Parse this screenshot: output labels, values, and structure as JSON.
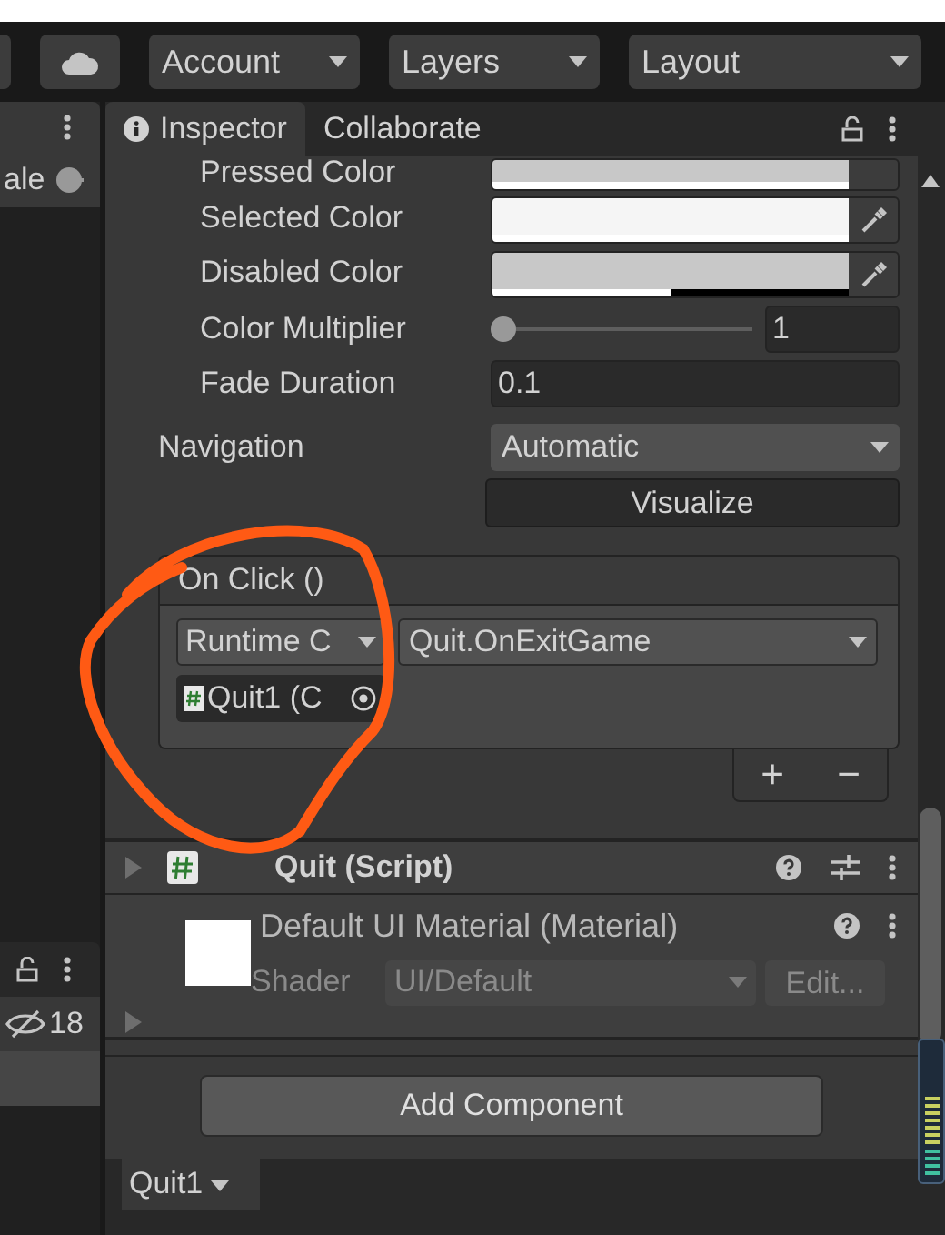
{
  "toolbar": {
    "buttons": [
      {
        "label": "Account"
      },
      {
        "label": "Layers"
      },
      {
        "label": "Layout"
      }
    ]
  },
  "left_panel": {
    "field_label": "ale",
    "hidden_count": "18"
  },
  "inspector": {
    "tabs": [
      {
        "label": "Inspector",
        "selected": true
      },
      {
        "label": "Collaborate",
        "selected": false
      }
    ],
    "color_rows": [
      {
        "label": "Pressed Color",
        "color": "#c8c8c8",
        "level": 1
      },
      {
        "label": "Selected Color",
        "color": "#f5f5f5",
        "level": 1
      },
      {
        "label": "Disabled Color",
        "color": "#c8c8c8",
        "level": 0.5
      }
    ],
    "color_multiplier": {
      "label": "Color Multiplier",
      "level": 0,
      "value": "1"
    },
    "fade_duration": {
      "label": "Fade Duration",
      "value": "0.1"
    },
    "navigation": {
      "label": "Navigation",
      "value": "Automatic",
      "button": "Visualize"
    },
    "on_click": {
      "title": "On Click ()",
      "runtime": "Runtime C",
      "function": "Quit.OnExitGame",
      "object": "Quit1 (C",
      "add": "+",
      "remove": "−"
    },
    "script_component": {
      "title": "Quit (Script)",
      "expanded": false
    },
    "material": {
      "title": "Default UI Material (Material)",
      "shader_label": "Shader",
      "shader": "UI/Default",
      "edit": "Edit..."
    },
    "add_component": "Add Component"
  },
  "bottom_tab": {
    "label": "Quit1"
  }
}
